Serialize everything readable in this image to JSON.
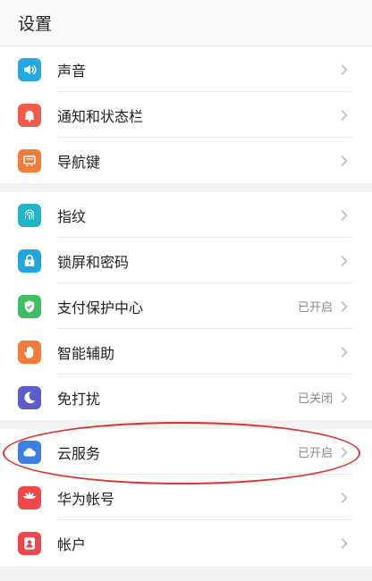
{
  "header": {
    "title": "设置"
  },
  "groups": [
    {
      "items": [
        {
          "label": "声音",
          "status": "",
          "icon": "speaker-icon",
          "color": "#29a8e0"
        },
        {
          "label": "通知和状态栏",
          "status": "",
          "icon": "bell-icon",
          "color": "#f25a4a"
        },
        {
          "label": "导航键",
          "status": "",
          "icon": "navigation-key-icon",
          "color": "#f47b3a"
        }
      ]
    },
    {
      "items": [
        {
          "label": "指纹",
          "status": "",
          "icon": "fingerprint-icon",
          "color": "#22b3c7"
        },
        {
          "label": "锁屏和密码",
          "status": "",
          "icon": "lock-icon",
          "color": "#22a6d9"
        },
        {
          "label": "支付保护中心",
          "status": "已开启",
          "icon": "shield-check-icon",
          "color": "#3fbf62"
        },
        {
          "label": "智能辅助",
          "status": "",
          "icon": "hand-icon",
          "color": "#f47b3a"
        },
        {
          "label": "免打扰",
          "status": "已关闭",
          "icon": "moon-icon",
          "color": "#5a5fc8"
        }
      ]
    },
    {
      "items": [
        {
          "label": "云服务",
          "status": "已开启",
          "icon": "cloud-icon",
          "color": "#3b7fe0"
        },
        {
          "label": "华为帐号",
          "status": "",
          "icon": "huawei-logo-icon",
          "color": "#f0474a"
        },
        {
          "label": "帐户",
          "status": "",
          "icon": "user-account-icon",
          "color": "#f0474a"
        }
      ]
    }
  ],
  "annotation_color": "#e0302c"
}
